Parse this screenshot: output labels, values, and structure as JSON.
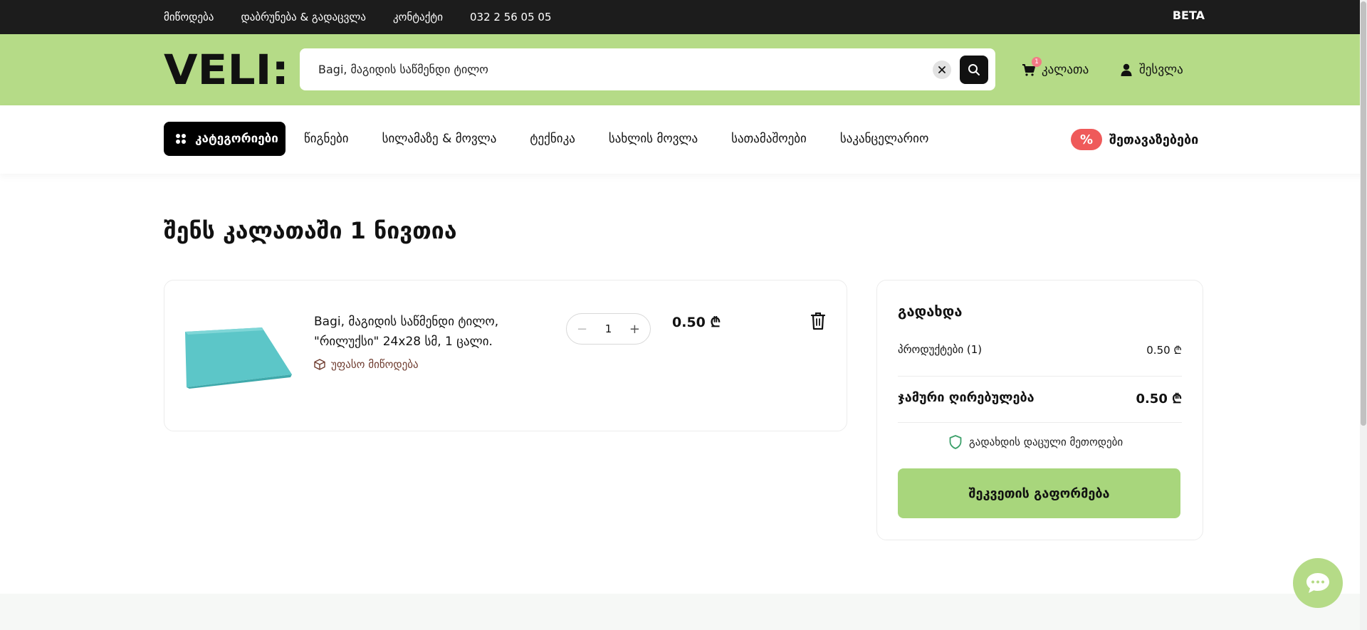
{
  "topbar": {
    "links": [
      "მიწოდება",
      "დაბრუნება & გადაცვლა",
      "კონტაქტი",
      "032 2 56 05 05"
    ],
    "beta": "BETA"
  },
  "header": {
    "logo_text": "VELI:",
    "search_value": "Bagi, მაგიდის საწმენდი ტილო",
    "cart_label": "კალათა",
    "cart_count": "1",
    "login_label": "შესვლა"
  },
  "nav": {
    "categories_label": "კატეგორიები",
    "items": [
      "წიგნები",
      "სილამაზე & მოვლა",
      "ტექნიკა",
      "სახლის მოვლა",
      "სათამაშოები",
      "საკანცელარიო"
    ],
    "offers_badge": "%",
    "offers_label": "შეთავაზებები"
  },
  "page": {
    "title": "შენს კალათაში 1 ნივთია"
  },
  "cart_item": {
    "name": "Bagi, მაგიდის საწმენდი ტილო, \"რილუქსი\" 24x28 სმ, 1 ცალი.",
    "delivery": "უფასო მიწოდება",
    "quantity": "1",
    "minus": "−",
    "plus": "+",
    "price": "0.50 ₾"
  },
  "summary": {
    "title": "გადახდა",
    "products_label": "პროდუქტები (1)",
    "products_value": "0.50 ₾",
    "total_label": "ჯამური ღირებულება",
    "total_value": "0.50 ₾",
    "secure_label": "გადახდის დაცული მეთოდები",
    "checkout_label": "შეკვეთის გაფორმება"
  },
  "colors": {
    "brand_green": "#b5db87",
    "checkout_green": "#a8d67c",
    "offers_red": "#ef5a5a",
    "delivery_brown": "#6e3b2e"
  },
  "icons": [
    "search-icon",
    "clear-icon",
    "cart-icon",
    "user-icon",
    "grid-icon",
    "box-icon",
    "trash-icon",
    "shield-icon",
    "chat-icon"
  ]
}
